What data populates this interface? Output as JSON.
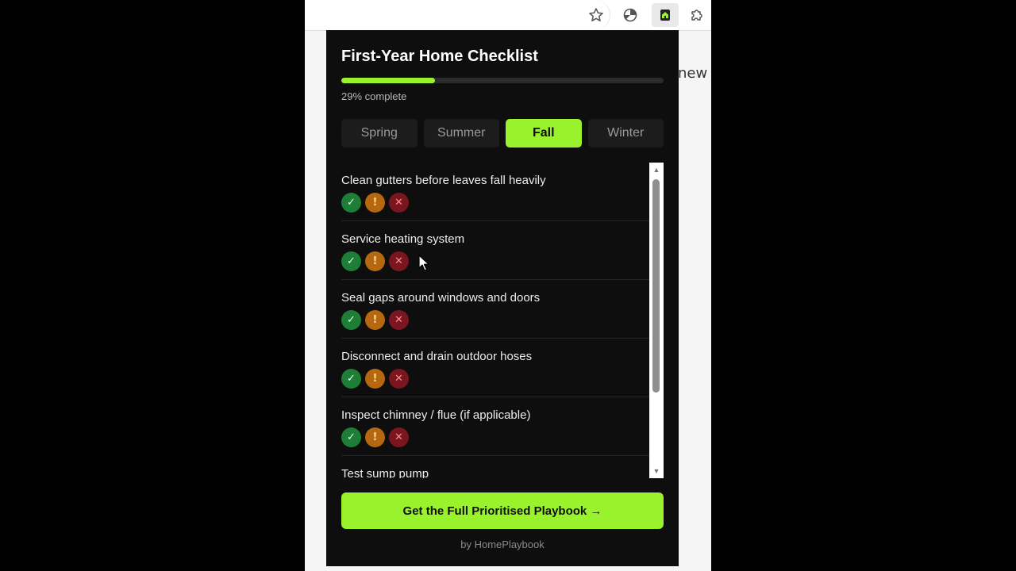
{
  "browser": {
    "background_text": "new l",
    "toolbar_icons": [
      "star-icon",
      "extension-icon",
      "homeplaybook-extension-icon",
      "puzzle-icon"
    ]
  },
  "popup": {
    "title": "First-Year Home Checklist",
    "progress": {
      "percent": 29,
      "label": "29% complete"
    },
    "tabs": [
      {
        "label": "Spring",
        "active": false
      },
      {
        "label": "Summer",
        "active": false
      },
      {
        "label": "Fall",
        "active": true
      },
      {
        "label": "Winter",
        "active": false
      }
    ],
    "status_glyphs": {
      "done": "✓",
      "warn": "!",
      "skip": "✕"
    },
    "items": [
      "Clean gutters before leaves fall heavily",
      "Service heating system",
      "Seal gaps around windows and doors",
      "Disconnect and drain outdoor hoses",
      "Inspect chimney / flue (if applicable)",
      "Test sump pump"
    ],
    "cta_label": "Get the Full Prioritised Playbook →",
    "byline": "by HomePlaybook"
  },
  "colors": {
    "accent": "#9af22c",
    "popup_bg": "#0e0e0e",
    "done": "#1e7d36",
    "warn": "#b5680f",
    "skip": "#7a1620"
  }
}
